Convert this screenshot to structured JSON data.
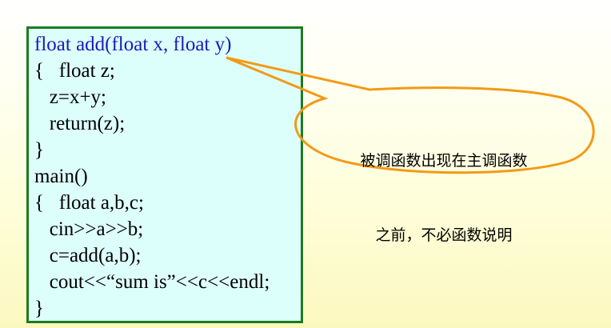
{
  "code": {
    "lines": [
      "float add(float x, float y)",
      "{   float z;",
      "   z=x+y;",
      "   return(z);",
      "}",
      "main()",
      "{   float a,b,c;",
      "   cin>>a>>b;",
      "   c=add(a,b);",
      "   cout<<“sum is”<<c<<endl;",
      "}"
    ]
  },
  "callout": {
    "line1": "被调函数出现在主调函数",
    "line2": "之前，不必函数说明"
  },
  "colors": {
    "code_box_border": "#1f7a1f",
    "code_box_fill": "#ddfffb",
    "highlight_text": "#1a1ab8",
    "callout_stroke": "#f29a16"
  }
}
